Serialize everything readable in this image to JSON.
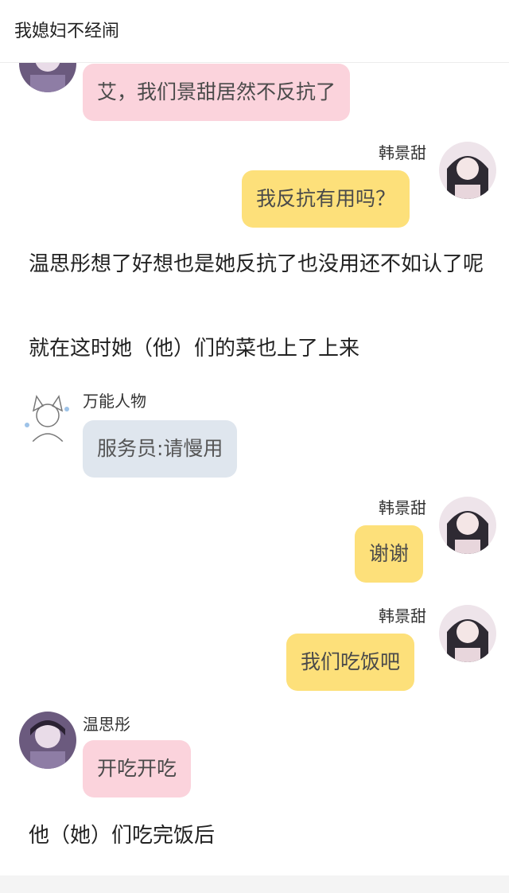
{
  "header": {
    "title": "我媳妇不经闹"
  },
  "messages": [
    {
      "speaker": "",
      "text": "艾，我们景甜居然不反抗了",
      "style": "pink"
    },
    {
      "speaker": "韩景甜",
      "text": "我反抗有用吗？",
      "style": "yellow"
    },
    {
      "narration_1": "温思彤想了好想也是她反抗了也没用还不如认了呢"
    },
    {
      "narration_2": "就在这时她（他）们的菜也上了上来"
    },
    {
      "speaker": "万能人物",
      "text": "服务员:请慢用",
      "style": "gray"
    },
    {
      "speaker": "韩景甜",
      "text": "谢谢",
      "style": "yellow"
    },
    {
      "speaker": "韩景甜",
      "text": "我们吃饭吧",
      "style": "yellow"
    },
    {
      "speaker": "温思彤",
      "text": "开吃开吃",
      "style": "pink"
    },
    {
      "narration_3": "他（她）们吃完饭后"
    }
  ],
  "avatars": {
    "wensitong": "avatar-wensitong",
    "hanjingtian": "avatar-hanjingtian",
    "wanneng": "avatar-wanneng-renwu"
  }
}
